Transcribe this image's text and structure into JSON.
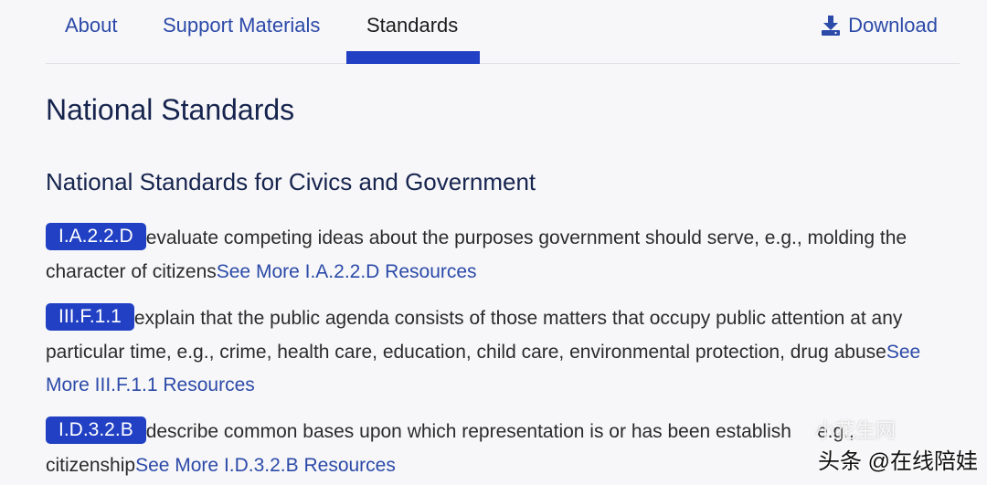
{
  "tabs": {
    "about": "About",
    "support_materials": "Support Materials",
    "standards": "Standards",
    "download": "Download"
  },
  "page_title": "National Standards",
  "section_title": "National Standards for Civics and Government",
  "standards": [
    {
      "code": "I.A.2.2.D",
      "text": "evaluate competing ideas about the purposes government should serve, e.g., molding the character of citizens",
      "link": "See More I.A.2.2.D Resources"
    },
    {
      "code": "III.F.1.1",
      "text": "explain that the public agenda consists of those matters that occupy public attention at any particular time, e.g., crime, health care, education, child care, environmental protection, drug abuse",
      "link": "See More III.F.1.1 Resources"
    },
    {
      "code": "I.D.3.2.B",
      "text": "describe common bases upon which representation is or has been establish",
      "text_tail": "e.g.,",
      "text_end": "citizenship",
      "link": "See More I.D.3.2.B Resources"
    }
  ],
  "watermark": {
    "faint": "小花生网",
    "main": "头条 @在线陪娃"
  },
  "colors": {
    "accent": "#2140c4",
    "link": "#2c4aa8",
    "heading": "#16244e",
    "background": "#f7f7f9"
  }
}
